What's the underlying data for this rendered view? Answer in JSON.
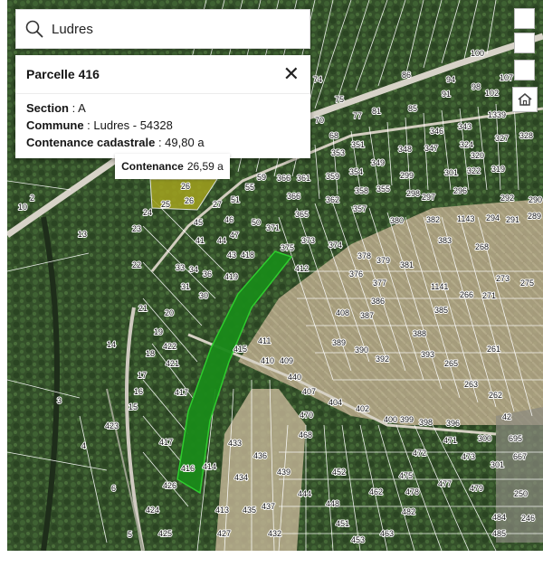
{
  "search": {
    "value": "Ludres",
    "icon": "search-icon"
  },
  "parcel_panel": {
    "title": "Parcelle 416",
    "section_label": "Section",
    "section_value": " : A",
    "commune_label": "Commune",
    "commune_value": " : Ludres - 54328",
    "contenance_label": "Contenance cadastrale",
    "contenance_value": " : 49,80 a",
    "close_icon": "close-icon"
  },
  "hover_tooltip": {
    "label": "Contenance",
    "value": "26,59 a"
  },
  "map_controls": {
    "home_icon": "home-icon"
  },
  "parcel_numbers": [
    "2",
    "10",
    "13",
    "3",
    "4",
    "6",
    "5",
    "14",
    "15",
    "16",
    "17",
    "18",
    "19",
    "20",
    "21",
    "22",
    "23",
    "24",
    "25",
    "26",
    "26",
    "27",
    "30",
    "31",
    "33",
    "34",
    "36",
    "41",
    "43",
    "44",
    "45",
    "46",
    "47",
    "50",
    "51",
    "55",
    "59",
    "365",
    "366",
    "361",
    "366",
    "362",
    "357",
    "359",
    "358",
    "355",
    "354",
    "349",
    "348",
    "353",
    "351",
    "68",
    "75",
    "77",
    "70",
    "74",
    "81",
    "85",
    "86",
    "91",
    "94",
    "98",
    "100",
    "102",
    "107",
    "1339",
    "343",
    "346",
    "347",
    "324",
    "327",
    "328",
    "320",
    "319",
    "322",
    "301",
    "299",
    "298",
    "297",
    "296",
    "292",
    "290",
    "291",
    "289",
    "294",
    "1143",
    "382",
    "380",
    "383",
    "268",
    "273",
    "275",
    "1141",
    "266",
    "271",
    "371",
    "373",
    "374",
    "375",
    "378",
    "379",
    "381",
    "412",
    "376",
    "377",
    "386",
    "387",
    "388",
    "389",
    "390",
    "392",
    "393",
    "408",
    "385",
    "265",
    "261",
    "263",
    "262",
    "411",
    "410",
    "409",
    "415",
    "419",
    "418",
    "422",
    "421",
    "417",
    "417",
    "416",
    "414",
    "413",
    "433",
    "434",
    "435",
    "436",
    "437",
    "439",
    "440",
    "407",
    "404",
    "402",
    "400",
    "399",
    "398",
    "396",
    "470",
    "471",
    "472",
    "473",
    "468",
    "452",
    "448",
    "444",
    "451",
    "453",
    "462",
    "463",
    "475",
    "477",
    "478",
    "479",
    "482",
    "484",
    "485",
    "300",
    "695",
    "667",
    "301",
    "250",
    "246",
    "42",
    "426",
    "424",
    "425",
    "427",
    "432",
    "423"
  ],
  "colors": {
    "selected_parcel": "#1a8a1a",
    "hover_parcel": "#a2a21e",
    "parcel_lines": "#ffffff"
  }
}
